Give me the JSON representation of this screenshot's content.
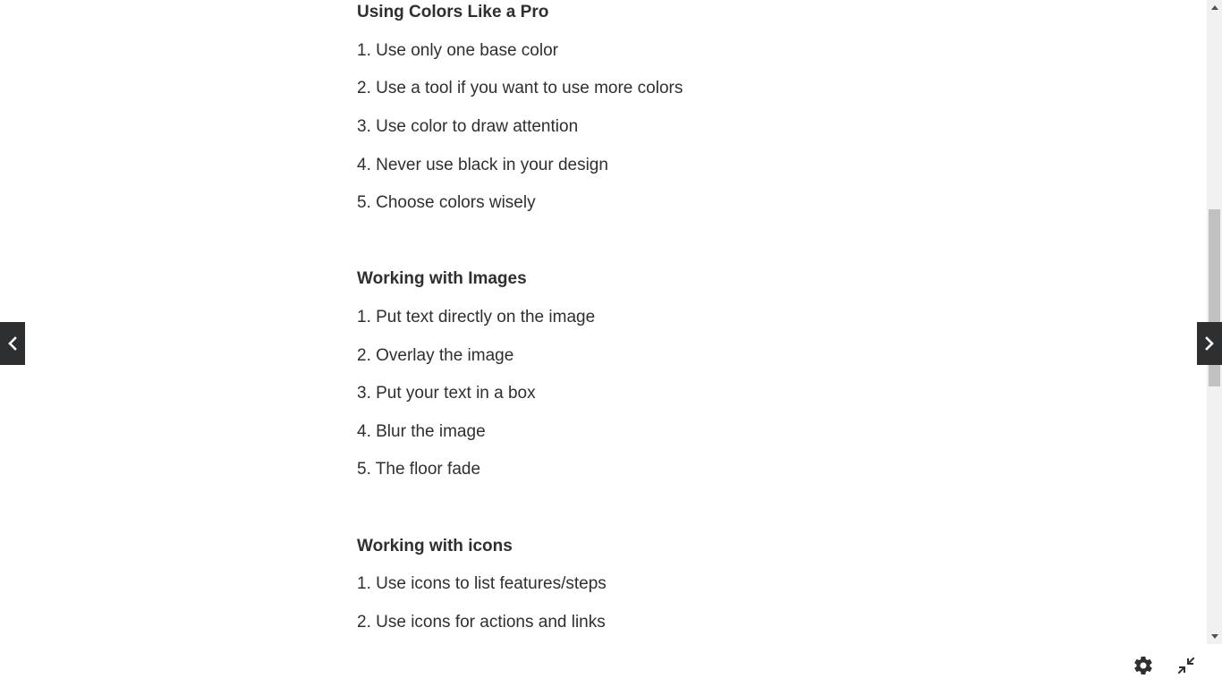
{
  "sections": [
    {
      "heading": "Using Colors Like a Pro",
      "items": [
        "1. Use only one base color",
        "2. Use a tool if you want to use more colors",
        "3. Use color to draw attention",
        "4. Never use black in your design",
        "5. Choose colors wisely"
      ]
    },
    {
      "heading": "Working with Images",
      "items": [
        "1. Put text directly on the image",
        "2. Overlay the image",
        "3. Put your text in a box",
        "4. Blur the image",
        "5. The floor fade"
      ]
    },
    {
      "heading": "Working with icons",
      "items": [
        "1. Use icons to list features/steps",
        "2. Use icons for actions and links"
      ]
    }
  ],
  "nav": {
    "prev_icon": "chevron-left-icon",
    "next_icon": "chevron-right-icon"
  },
  "toolbar": {
    "settings_icon": "gear-icon",
    "collapse_icon": "collapse-fullscreen-icon"
  },
  "colors": {
    "text": "#2d2f31",
    "nav_bg": "#2d2f31",
    "background": "#ffffff"
  }
}
